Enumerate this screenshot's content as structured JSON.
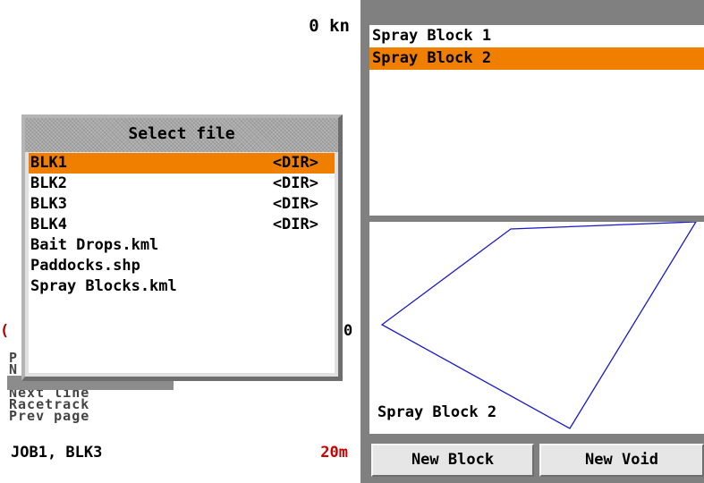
{
  "status": {
    "speed": "0 kn",
    "job": "JOB1, BLK3",
    "scale": "20m",
    "edge_left": "(",
    "edge_right": "0"
  },
  "menu": {
    "items": [
      "P",
      "N",
      "Next line",
      "Racetrack",
      "Prev page"
    ]
  },
  "dialog": {
    "title": "Select file",
    "files": [
      {
        "name": "BLK1",
        "tag": "<DIR>",
        "selected": true
      },
      {
        "name": "BLK2",
        "tag": "<DIR>"
      },
      {
        "name": "BLK3",
        "tag": "<DIR>"
      },
      {
        "name": "BLK4",
        "tag": "<DIR>"
      },
      {
        "name": "Bait Drops.kml",
        "tag": ""
      },
      {
        "name": "Paddocks.shp",
        "tag": ""
      },
      {
        "name": "Spray Blocks.kml",
        "tag": ""
      }
    ]
  },
  "blocks": {
    "items": [
      "Spray Block 1",
      "Spray Block 2"
    ],
    "selected_index": 1
  },
  "map": {
    "label": "Spray Block 2",
    "line_color": "#1a1ac8"
  },
  "buttons": {
    "new_block": "New Block",
    "new_void": "New Void"
  },
  "colors": {
    "highlight": "#f07f00",
    "alert": "#cc0000"
  }
}
